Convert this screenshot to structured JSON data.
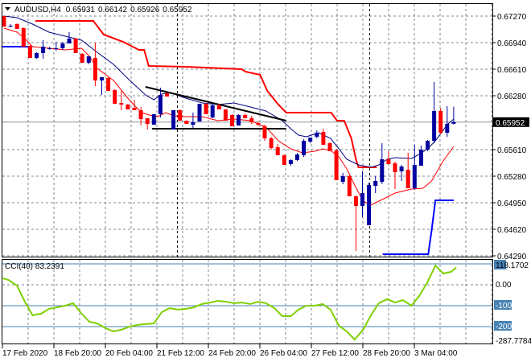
{
  "header": {
    "symbol": "AUDUSD,H4",
    "open": "0.65931",
    "high": "0.66142",
    "low": "0.65926",
    "close": "0.65952"
  },
  "colors": {
    "bull": "#0000a0",
    "bear": "#ff0000",
    "ma_fast": "#ff0000",
    "ma_slow": "#000080",
    "upper_channel": "#ff0000",
    "lower_channel": "#0000ff",
    "trendline": "#000000",
    "cci": "#7fd000",
    "cci_level": "#4682b4",
    "grid": "#808890"
  },
  "chart_data": [
    {
      "type": "candlestick",
      "title": "AUDUSD,H4",
      "ylim": [
        0.6429,
        0.6727
      ],
      "price_labels": [
        "0.67270",
        "0.66940",
        "0.66610",
        "0.66280",
        "0.65610",
        "0.65280",
        "0.64950",
        "0.64620",
        "0.64290"
      ],
      "current_price": "0.65952",
      "time_labels": [
        "17 Feb 2020",
        "18 Feb 20:00",
        "20 Feb 04:00",
        "21 Feb 12:00",
        "24 Feb 20:00",
        "26 Feb 04:00",
        "27 Feb 12:00",
        "28 Feb 20:00",
        "3 Mar 04:00"
      ],
      "period_separators": [
        26.6,
        56.1
      ],
      "candles_ohlc": [
        [
          0.6727,
          0.6727,
          0.6714,
          0.6714
        ],
        [
          0.6715,
          0.6717,
          0.6713,
          0.6715
        ],
        [
          0.6717,
          0.6718,
          0.6711,
          0.6711
        ],
        [
          0.6712,
          0.6713,
          0.6689,
          0.6689
        ],
        [
          0.669,
          0.6691,
          0.6675,
          0.6675
        ],
        [
          0.6675,
          0.6682,
          0.6674,
          0.6681
        ],
        [
          0.6681,
          0.6697,
          0.6674,
          0.6689
        ],
        [
          0.6687,
          0.6689,
          0.6685,
          0.6687
        ],
        [
          0.6686,
          0.6695,
          0.6684,
          0.6687
        ],
        [
          0.6687,
          0.6695,
          0.6685,
          0.6693
        ],
        [
          0.6693,
          0.6707,
          0.6693,
          0.6699
        ],
        [
          0.6699,
          0.67,
          0.6681,
          0.6681
        ],
        [
          0.668,
          0.6681,
          0.6669,
          0.6669
        ],
        [
          0.6669,
          0.6677,
          0.6667,
          0.6677
        ],
        [
          0.6675,
          0.6694,
          0.664,
          0.6647
        ],
        [
          0.6647,
          0.6651,
          0.6629,
          0.6651
        ],
        [
          0.665,
          0.6651,
          0.6634,
          0.6634
        ],
        [
          0.6635,
          0.6636,
          0.6618,
          0.6618
        ],
        [
          0.6619,
          0.6634,
          0.661,
          0.6617
        ],
        [
          0.6617,
          0.6618,
          0.6611,
          0.6611
        ],
        [
          0.6613,
          0.6623,
          0.661,
          0.661
        ],
        [
          0.661,
          0.6614,
          0.6591,
          0.6599
        ],
        [
          0.66,
          0.66,
          0.6586,
          0.6593
        ],
        [
          0.6592,
          0.6605,
          0.6592,
          0.6605
        ],
        [
          0.6605,
          0.6638,
          0.6601,
          0.6629
        ],
        [
          0.6631,
          0.6632,
          0.6627,
          0.6627
        ],
        [
          0.6586,
          0.661,
          0.6586,
          0.661
        ],
        [
          0.661,
          0.6611,
          0.6597,
          0.6597
        ],
        [
          0.6597,
          0.6597,
          0.6593,
          0.6593
        ],
        [
          0.6592,
          0.6607,
          0.6587,
          0.6595
        ],
        [
          0.6596,
          0.6618,
          0.6596,
          0.6618
        ],
        [
          0.6618,
          0.6619,
          0.6605,
          0.6605
        ],
        [
          0.6601,
          0.6617,
          0.66,
          0.6616
        ],
        [
          0.6616,
          0.6618,
          0.6611,
          0.6611
        ],
        [
          0.6611,
          0.6611,
          0.6597,
          0.6597
        ],
        [
          0.6604,
          0.6605,
          0.659,
          0.659
        ],
        [
          0.6591,
          0.6605,
          0.6591,
          0.6604
        ],
        [
          0.6604,
          0.6606,
          0.66,
          0.66
        ],
        [
          0.66,
          0.6603,
          0.6593,
          0.6595
        ],
        [
          0.6594,
          0.6596,
          0.659,
          0.6592
        ],
        [
          0.659,
          0.6592,
          0.6572,
          0.6575
        ],
        [
          0.6575,
          0.6577,
          0.6561,
          0.6563
        ],
        [
          0.6564,
          0.6568,
          0.6554,
          0.6554
        ],
        [
          0.6554,
          0.6555,
          0.6542,
          0.6542
        ],
        [
          0.6543,
          0.6549,
          0.6541,
          0.6548
        ],
        [
          0.6548,
          0.6557,
          0.6547,
          0.6555
        ],
        [
          0.6554,
          0.6574,
          0.6552,
          0.6572
        ],
        [
          0.6571,
          0.6576,
          0.6569,
          0.6576
        ],
        [
          0.6577,
          0.6585,
          0.6575,
          0.6582
        ],
        [
          0.6583,
          0.6587,
          0.6567,
          0.6567
        ],
        [
          0.6569,
          0.657,
          0.6559,
          0.6559
        ],
        [
          0.656,
          0.6562,
          0.6523,
          0.6523
        ],
        [
          0.6521,
          0.6532,
          0.6518,
          0.6528
        ],
        [
          0.6528,
          0.653,
          0.6503,
          0.6503
        ],
        [
          0.6503,
          0.6504,
          0.6435,
          0.6491
        ],
        [
          0.6491,
          0.6534,
          0.6477,
          0.6507
        ],
        [
          0.6467,
          0.652,
          0.6467,
          0.6517
        ],
        [
          0.6516,
          0.6528,
          0.6507,
          0.6522
        ],
        [
          0.6521,
          0.6569,
          0.6518,
          0.6549
        ],
        [
          0.6549,
          0.6559,
          0.6543,
          0.6543
        ],
        [
          0.6544,
          0.6546,
          0.6512,
          0.6533
        ],
        [
          0.6534,
          0.6542,
          0.6522,
          0.654
        ],
        [
          0.6536,
          0.6557,
          0.6513,
          0.6513
        ],
        [
          0.6513,
          0.6567,
          0.6511,
          0.6542
        ],
        [
          0.6541,
          0.6566,
          0.6541,
          0.6561
        ],
        [
          0.6561,
          0.6573,
          0.6559,
          0.6572
        ],
        [
          0.6572,
          0.6645,
          0.6569,
          0.6609
        ],
        [
          0.6609,
          0.6613,
          0.658,
          0.6582
        ],
        [
          0.6582,
          0.6615,
          0.6577,
          0.6593
        ],
        [
          0.65931,
          0.66142,
          0.65926,
          0.65952
        ]
      ],
      "ma_slow": [
        [
          0,
          0.6727
        ],
        [
          2,
          0.6725
        ],
        [
          4.4,
          0.6717
        ],
        [
          6.9,
          0.6707
        ],
        [
          9.4,
          0.6702
        ],
        [
          11.9,
          0.6697
        ],
        [
          14.3,
          0.6682
        ],
        [
          16.8,
          0.6667
        ],
        [
          19.3,
          0.6647
        ],
        [
          21.7,
          0.6629
        ],
        [
          23,
          0.6623
        ],
        [
          24.2,
          0.663
        ],
        [
          25.4,
          0.6632
        ],
        [
          27.9,
          0.6625
        ],
        [
          30.4,
          0.6619
        ],
        [
          32.8,
          0.6617
        ],
        [
          35.3,
          0.6619
        ],
        [
          37.8,
          0.6614
        ],
        [
          40.2,
          0.6609
        ],
        [
          42.7,
          0.6597
        ],
        [
          44,
          0.6587
        ],
        [
          45.2,
          0.6579
        ],
        [
          46.4,
          0.6577
        ],
        [
          48.3,
          0.6582
        ],
        [
          50.1,
          0.6575
        ],
        [
          51.4,
          0.6562
        ],
        [
          52.6,
          0.6549
        ],
        [
          54.4,
          0.6542
        ],
        [
          56.3,
          0.6539
        ],
        [
          57.5,
          0.6542
        ],
        [
          58.8,
          0.6549
        ],
        [
          60,
          0.6551
        ],
        [
          62.5,
          0.655
        ],
        [
          63.7,
          0.6555
        ],
        [
          65,
          0.6562
        ],
        [
          66.2,
          0.6572
        ],
        [
          68,
          0.6592
        ],
        [
          69,
          0.6599
        ]
      ],
      "ma_fast": [
        [
          0,
          0.6712
        ],
        [
          2,
          0.6707
        ],
        [
          3.2,
          0.6699
        ],
        [
          4.4,
          0.6689
        ],
        [
          6.9,
          0.6687
        ],
        [
          9.4,
          0.6685
        ],
        [
          11.9,
          0.6687
        ],
        [
          13.1,
          0.6677
        ],
        [
          14.3,
          0.6662
        ],
        [
          16.8,
          0.6647
        ],
        [
          19.3,
          0.6622
        ],
        [
          21.1,
          0.6607
        ],
        [
          22.3,
          0.6604
        ],
        [
          23.6,
          0.6602
        ],
        [
          24.8,
          0.6607
        ],
        [
          26.1,
          0.6603
        ],
        [
          27.9,
          0.6602
        ],
        [
          30.4,
          0.6602
        ],
        [
          32.8,
          0.6597
        ],
        [
          35.3,
          0.6599
        ],
        [
          37.8,
          0.6597
        ],
        [
          40.2,
          0.6589
        ],
        [
          42.1,
          0.6572
        ],
        [
          44,
          0.6562
        ],
        [
          45.8,
          0.6557
        ],
        [
          47.7,
          0.6559
        ],
        [
          48.9,
          0.6562
        ],
        [
          50.1,
          0.656
        ],
        [
          51.4,
          0.6552
        ],
        [
          52.6,
          0.6537
        ],
        [
          53.8,
          0.6517
        ],
        [
          55.1,
          0.6497
        ],
        [
          56.3,
          0.6492
        ],
        [
          57.5,
          0.6497
        ],
        [
          58.8,
          0.6502
        ],
        [
          60,
          0.6507
        ],
        [
          62.5,
          0.6512
        ],
        [
          64.3,
          0.6513
        ],
        [
          65.6,
          0.6522
        ],
        [
          67.4,
          0.6547
        ],
        [
          69,
          0.6565
        ]
      ],
      "upper_channel": [
        [
          4.8,
          0.6721
        ],
        [
          13.7,
          0.6721
        ],
        [
          15.3,
          0.6704
        ],
        [
          18.3,
          0.6695
        ],
        [
          20.7,
          0.6685
        ],
        [
          21.5,
          0.6685
        ],
        [
          22.2,
          0.6665
        ],
        [
          27.9,
          0.6664
        ],
        [
          36.5,
          0.6661
        ],
        [
          37,
          0.6658
        ],
        [
          39.3,
          0.6654
        ],
        [
          40.4,
          0.6634
        ],
        [
          42.1,
          0.6617
        ],
        [
          43.3,
          0.6607
        ],
        [
          50.2,
          0.6607
        ],
        [
          51.1,
          0.6597
        ],
        [
          52.2,
          0.6597
        ],
        [
          53.3,
          0.6575
        ],
        [
          54,
          0.6549
        ],
        [
          54.4,
          0.6539
        ],
        [
          57.2,
          0.6539
        ]
      ],
      "lower_channel": [
        [
          [
            -0.4,
            0.6689
          ],
          [
            3.8,
            0.6689
          ]
        ],
        [
          [
            58.1,
            0.6431
          ],
          [
            65.1,
            0.6431
          ],
          [
            65.6,
            0.646
          ],
          [
            66.2,
            0.6498
          ],
          [
            69,
            0.6498
          ]
        ]
      ],
      "trendlines": [
        [
          [
            21.7,
            0.6639
          ],
          [
            43.3,
            0.6597
          ]
        ],
        [
          [
            22.7,
            0.6587
          ],
          [
            43.3,
            0.6587
          ]
        ]
      ]
    },
    {
      "type": "line",
      "title": "CCI(40) 83.2391",
      "ylim": [
        -287.7784,
        118.1702
      ],
      "axis_labels": [
        "118.1702",
        "0.00",
        "-100",
        "-200",
        "-287.7784"
      ],
      "levels": [
        100,
        -100,
        -200
      ],
      "series": [
        {
          "name": "CCI(40)",
          "points": [
            [
              -0.2,
              31
            ],
            [
              0.7,
              23
            ],
            [
              2,
              -4
            ],
            [
              3.2,
              -81
            ],
            [
              4.4,
              -146
            ],
            [
              5.7,
              -138
            ],
            [
              6.9,
              -115
            ],
            [
              8.1,
              -108
            ],
            [
              9.4,
              -100
            ],
            [
              10.6,
              -88
            ],
            [
              11.9,
              -138
            ],
            [
              13.1,
              -177
            ],
            [
              14.3,
              -185
            ],
            [
              15.6,
              -208
            ],
            [
              16.8,
              -223
            ],
            [
              18,
              -215
            ],
            [
              19.3,
              -200
            ],
            [
              20.5,
              -192
            ],
            [
              21.7,
              -188
            ],
            [
              23,
              -185
            ],
            [
              24.2,
              -131
            ],
            [
              25.4,
              -112
            ],
            [
              26.7,
              -119
            ],
            [
              27.9,
              -115
            ],
            [
              29.1,
              -108
            ],
            [
              30.4,
              -92
            ],
            [
              31.6,
              -85
            ],
            [
              32.8,
              -77
            ],
            [
              34.1,
              -81
            ],
            [
              35.3,
              -88
            ],
            [
              36.5,
              -85
            ],
            [
              37.8,
              -92
            ],
            [
              39,
              -81
            ],
            [
              40.2,
              -88
            ],
            [
              41.5,
              -112
            ],
            [
              42.7,
              -150
            ],
            [
              44,
              -150
            ],
            [
              45.2,
              -119
            ],
            [
              46.4,
              -100
            ],
            [
              47.7,
              -100
            ],
            [
              48.9,
              -92
            ],
            [
              50.1,
              -119
            ],
            [
              51.4,
              -196
            ],
            [
              52.6,
              -223
            ],
            [
              53.8,
              -262
            ],
            [
              55.1,
              -215
            ],
            [
              56.3,
              -146
            ],
            [
              57.5,
              -88
            ],
            [
              58.8,
              -69
            ],
            [
              60,
              -85
            ],
            [
              61.2,
              -73
            ],
            [
              62.5,
              -100
            ],
            [
              63.7,
              -54
            ],
            [
              64.9,
              8
            ],
            [
              66.2,
              92
            ],
            [
              67.4,
              54
            ],
            [
              68.6,
              62
            ],
            [
              69.4,
              83.2
            ]
          ]
        }
      ]
    }
  ]
}
